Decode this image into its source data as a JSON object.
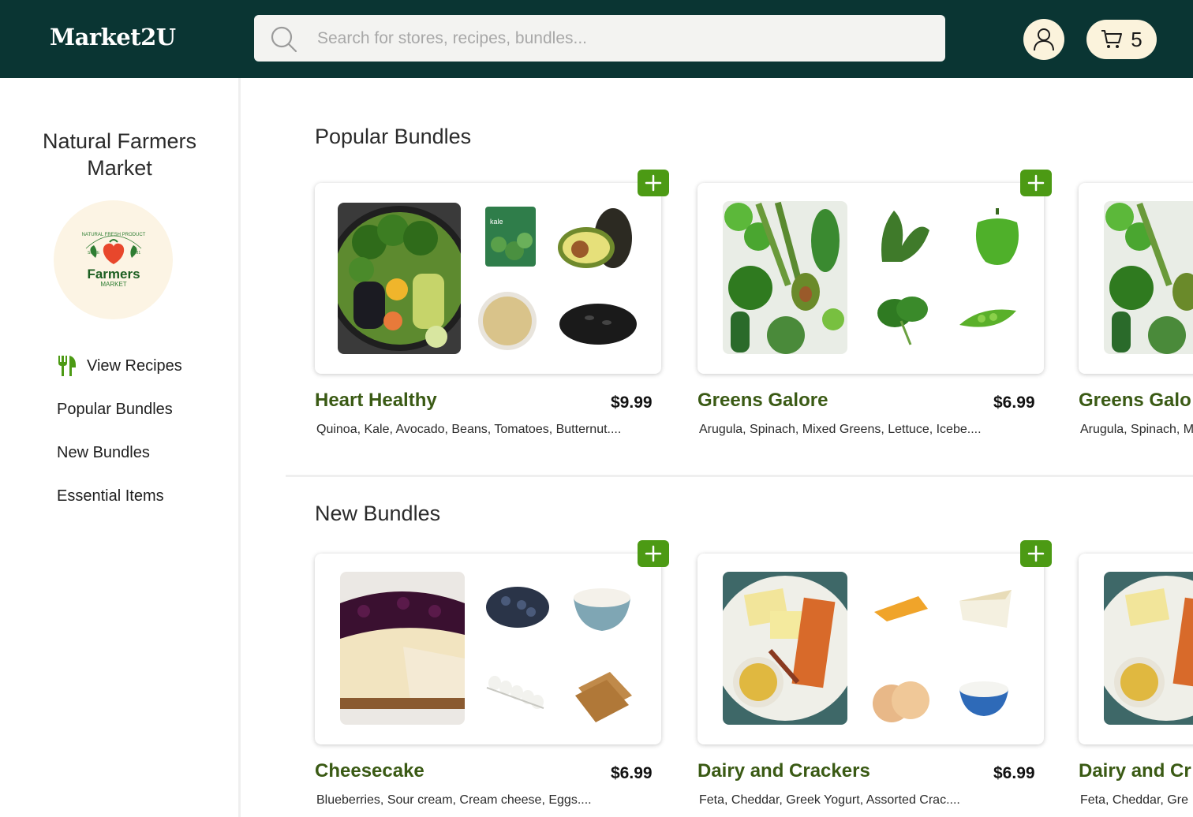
{
  "header": {
    "logo": "Market2U",
    "search_placeholder": "Search for stores, recipes, bundles...",
    "cart_count": "5"
  },
  "sidebar": {
    "store_name": "Natural Farmers Market",
    "logo_text": "Farmers",
    "logo_sub": "MARKET",
    "logo_since": "SINCE",
    "logo_year": "1981",
    "logo_top": "NATURAL FRESH PRODUCT",
    "nav": [
      {
        "label": "View Recipes",
        "icon": "fork-knife-icon"
      },
      {
        "label": "Popular Bundles"
      },
      {
        "label": "New Bundles"
      },
      {
        "label": "Essential Items"
      }
    ]
  },
  "sections": {
    "popular": {
      "title": "Popular Bundles",
      "items": [
        {
          "name": "Heart Healthy",
          "price": "$9.99",
          "desc": "Quinoa, Kale, Avocado, Beans, Tomatoes, Butternut....",
          "thumb_label": "kale"
        },
        {
          "name": "Greens Galore",
          "price": "$6.99",
          "desc": "Arugula, Spinach, Mixed Greens, Lettuce, Icebe...."
        },
        {
          "name": "Greens Galo",
          "desc": "Arugula, Spinach, M"
        }
      ]
    },
    "new": {
      "title": "New Bundles",
      "items": [
        {
          "name": "Cheesecake",
          "price": "$6.99",
          "desc": "Blueberries, Sour cream, Cream cheese, Eggs...."
        },
        {
          "name": "Dairy and Crackers",
          "price": "$6.99",
          "desc": "Feta, Cheddar, Greek Yogurt, Assorted Crac...."
        },
        {
          "name": "Dairy and Cr",
          "desc": "Feta, Cheddar, Gre"
        }
      ]
    }
  },
  "colors": {
    "header_bg": "#0a3533",
    "accent_green": "#4c9a14",
    "bundle_name": "#3a5a14",
    "button_cream": "#fbf3dc"
  }
}
